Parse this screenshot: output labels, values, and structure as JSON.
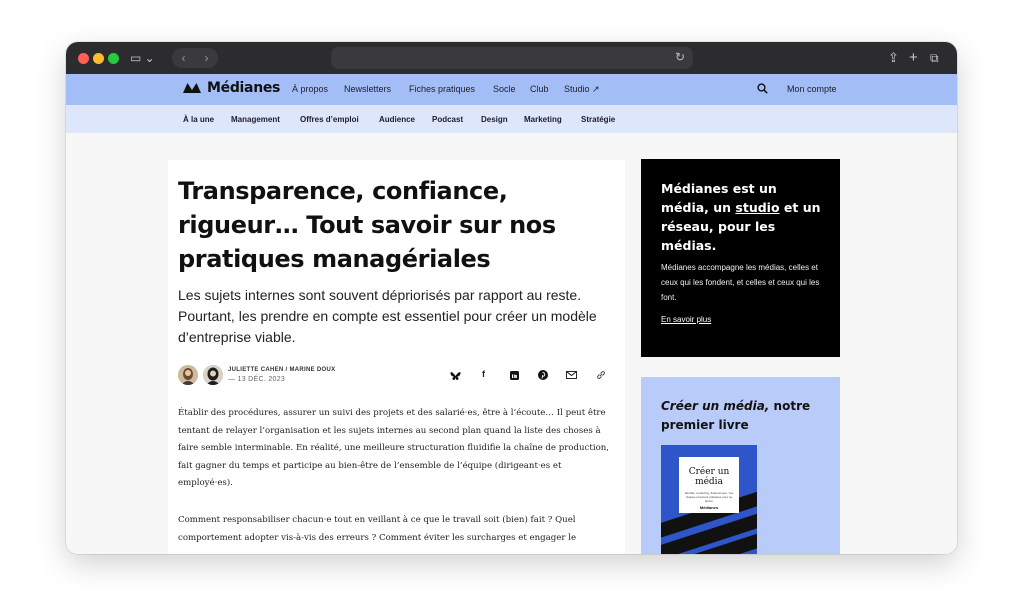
{
  "browser": {
    "back_icon": "chevron-left-icon",
    "forward_icon": "chevron-right-icon",
    "reload_icon": "reload-icon"
  },
  "topnav": {
    "logo_text": "Médianes",
    "links": [
      "À propos",
      "Newsletters",
      "Fiches pratiques",
      "Socle",
      "Club",
      "Studio ↗"
    ],
    "account": "Mon compte"
  },
  "subnav": {
    "links": [
      "À la une",
      "Management",
      "Offres d’emploi",
      "Audience",
      "Podcast",
      "Design",
      "Marketing",
      "Stratégie"
    ]
  },
  "article": {
    "title": "Transparence, confiance, rigueur… Tout savoir sur nos pratiques managériales",
    "dek": "Les sujets internes sont souvent dépriorisés par rapport au reste. Pourtant, les prendre en compte est essentiel pour créer un modèle d’entreprise viable.",
    "authors": "JULIETTE CAHEN / MARINE DOUX",
    "date": "— 13 DÉC. 2023",
    "paragraph1": "Établir des procédures, assurer un suivi des projets et des salarié·es, être à l’écoute… Il peut être tentant de relayer l’organisation et les sujets internes au second plan quand la liste des choses à faire semble interminable. En réalité, une meilleure structuration fluidifie la chaîne de production, fait gagner du temps et participe au bien-être de l’ensemble de l’équipe (dirigeant·es et employé·es).",
    "paragraph2": "Comment responsabiliser chacun·e tout en veillant à ce que le travail soit (bien) fait ? Quel comportement adopter vis-à-vis des erreurs ? Comment éviter les surcharges et engager le"
  },
  "promo_black": {
    "title_a": "Médianes est un média, un ",
    "title_link": "studio",
    "title_b": " et un réseau, pour les médias.",
    "text": "Médianes accompagne les médias, celles et ceux qui les fondent, et celles et ceux qui les font.",
    "more": "En savoir plus"
  },
  "promo_blue": {
    "title_em": "Créer un média,",
    "title_rest": " notre premier livre",
    "book_title": "Créer un média",
    "book_subtitle": "Identité, rendering, financement : les risques et leviers pratiques pour se lancer",
    "book_publisher": "Médianes"
  }
}
